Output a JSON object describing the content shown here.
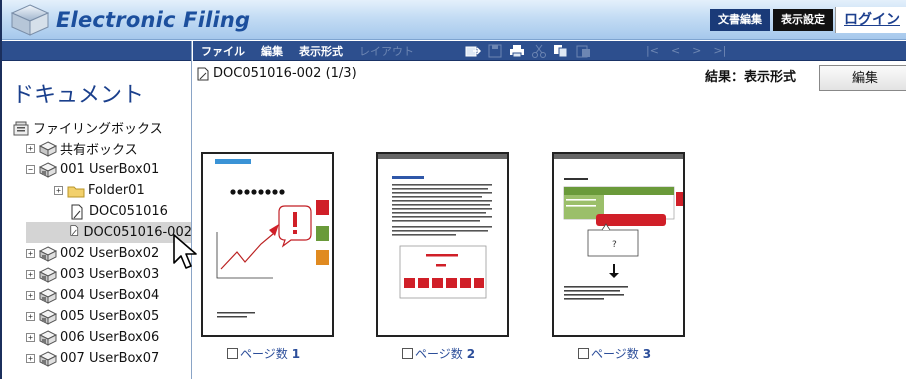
{
  "header": {
    "app_title": "Electronic Filing",
    "btn_doc_edit": "文書編集",
    "btn_display_settings": "表示設定",
    "btn_login": "ログイン"
  },
  "sidebar": {
    "heading": "ドキュメント",
    "tree": [
      {
        "label": "ファイリングボックス",
        "icon": "filing-box-icon",
        "expander": "",
        "indent": 0
      },
      {
        "label": "共有ボックス",
        "icon": "shared-box-icon",
        "expander": "+",
        "indent": 1
      },
      {
        "label": "001 UserBox01",
        "icon": "userbox-icon",
        "expander": "−",
        "indent": 1
      },
      {
        "label": "Folder01",
        "icon": "folder-icon",
        "expander": "+",
        "indent": 2
      },
      {
        "label": "DOC051016",
        "icon": "document-icon",
        "expander": "",
        "indent": 3
      },
      {
        "label": "DOC051016-002",
        "icon": "document-icon",
        "expander": "",
        "indent": 3,
        "selected": true
      },
      {
        "label": "002 UserBox02",
        "icon": "userbox-icon",
        "expander": "+",
        "indent": 1
      },
      {
        "label": "003 UserBox03",
        "icon": "userbox-icon",
        "expander": "+",
        "indent": 1
      },
      {
        "label": "004 UserBox04",
        "icon": "userbox-icon",
        "expander": "+",
        "indent": 1
      },
      {
        "label": "005 UserBox05",
        "icon": "userbox-icon",
        "expander": "+",
        "indent": 1
      },
      {
        "label": "006 UserBox06",
        "icon": "userbox-icon",
        "expander": "+",
        "indent": 1
      },
      {
        "label": "007 UserBox07",
        "icon": "userbox-icon",
        "expander": "+",
        "indent": 1
      }
    ]
  },
  "menubar": {
    "file": "ファイル",
    "edit": "編集",
    "view_format": "表示形式",
    "layout": "レイアウト",
    "nav_first": "|<",
    "nav_prev": "<",
    "nav_next": ">",
    "nav_last": ">|"
  },
  "document": {
    "title": "DOC051016-002  (1/3)",
    "result_label": "結果：表示形式",
    "edit_button": "編集"
  },
  "pages": [
    {
      "label": "ページ数",
      "number": "1"
    },
    {
      "label": "ページ数",
      "number": "2"
    },
    {
      "label": "ページ数",
      "number": "3"
    }
  ],
  "colors": {
    "accent": "#1c4f9d",
    "menubar": "#2d4f8e",
    "selection": "#d4d4d4",
    "thumb_red": "#e0202a",
    "thumb_green": "#6a9a3a",
    "thumb_orange": "#e08a20"
  }
}
